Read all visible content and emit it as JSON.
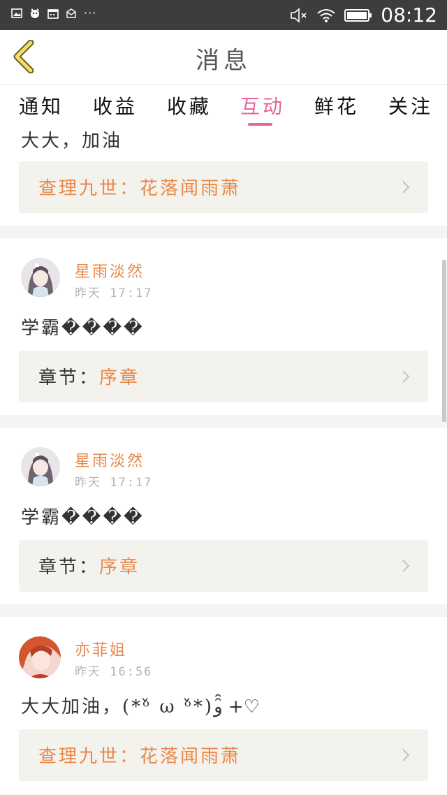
{
  "status_bar": {
    "time": "08:12",
    "icons": [
      "image-icon",
      "cat-icon",
      "calendar-icon",
      "mail-icon",
      "more-icon",
      "mute-icon",
      "wifi-icon",
      "battery-icon"
    ]
  },
  "header": {
    "title": "消息"
  },
  "tabs": [
    {
      "label": "通知"
    },
    {
      "label": "收益"
    },
    {
      "label": "收藏"
    },
    {
      "label": "互动",
      "active": true
    },
    {
      "label": "鲜花"
    },
    {
      "label": "关注"
    }
  ],
  "messages": [
    {
      "text": "大大，加油",
      "card": {
        "prefix": "",
        "value": "查理九世：花落闻雨萧"
      }
    },
    {
      "user": "星雨淡然",
      "time": "昨天 17:17",
      "text": "学霸����",
      "card": {
        "prefix": "章节：",
        "value": "序章"
      }
    },
    {
      "user": "星雨淡然",
      "time": "昨天 17:17",
      "text": "学霸����",
      "card": {
        "prefix": "章节：",
        "value": "序章"
      }
    },
    {
      "user": "亦菲姐",
      "time": "昨天 16:56",
      "text": "大大加油，(*ᵒ̌ ω ᵒ̌*)و ̑̑+♡",
      "card": {
        "prefix": "",
        "value": "查理九世：花落闻雨萧"
      }
    }
  ],
  "colors": {
    "accent_pink": "#e6649a",
    "accent_orange": "#e8884a",
    "status_bar": "#3d3d3d"
  }
}
